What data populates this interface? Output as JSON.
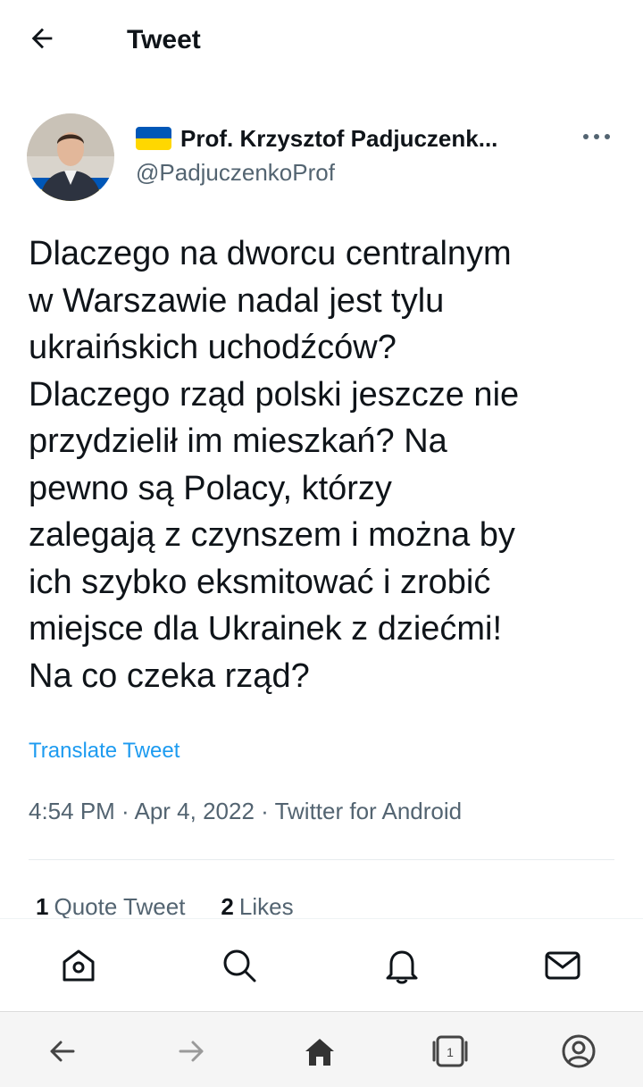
{
  "header": {
    "title": "Tweet",
    "back_icon": "arrow-left-icon"
  },
  "author": {
    "display_name": "Prof. Krzysztof Padjuczenk...",
    "handle": "@PadjuczenkoProf",
    "flag_colors": [
      "#0057b7",
      "#ffd700"
    ]
  },
  "tweet": {
    "lines": [
      "Dlaczego na dworcu centralnym",
      "w Warszawie nadal jest tylu",
      "ukraińskich uchodźców?",
      "Dlaczego rząd polski jeszcze nie",
      "przydzielił im mieszkań? Na",
      "pewno są Polacy, którzy",
      "zalegają z czynszem i można by",
      "ich szybko eksmitować i zrobić",
      "miejsce dla Ukrainek z dziećmi!",
      "Na co czeka rząd?"
    ],
    "translate_label": "Translate Tweet",
    "meta": "4:54 PM · Apr 4, 2022 · Twitter for Android"
  },
  "stats": {
    "quote_count": "1",
    "quote_label": "Quote Tweet",
    "likes_count": "2",
    "likes_label": "Likes"
  },
  "tabbar": [
    "home-icon",
    "search-icon",
    "bell-icon",
    "mail-icon"
  ],
  "navbar": [
    "back-arrow-icon",
    "forward-arrow-icon",
    "home-icon",
    "tabs-icon",
    "account-icon"
  ],
  "navbar_tab_count": "1",
  "colors": {
    "link": "#1d9bf0",
    "secondary": "#536471",
    "text": "#0f1419"
  }
}
